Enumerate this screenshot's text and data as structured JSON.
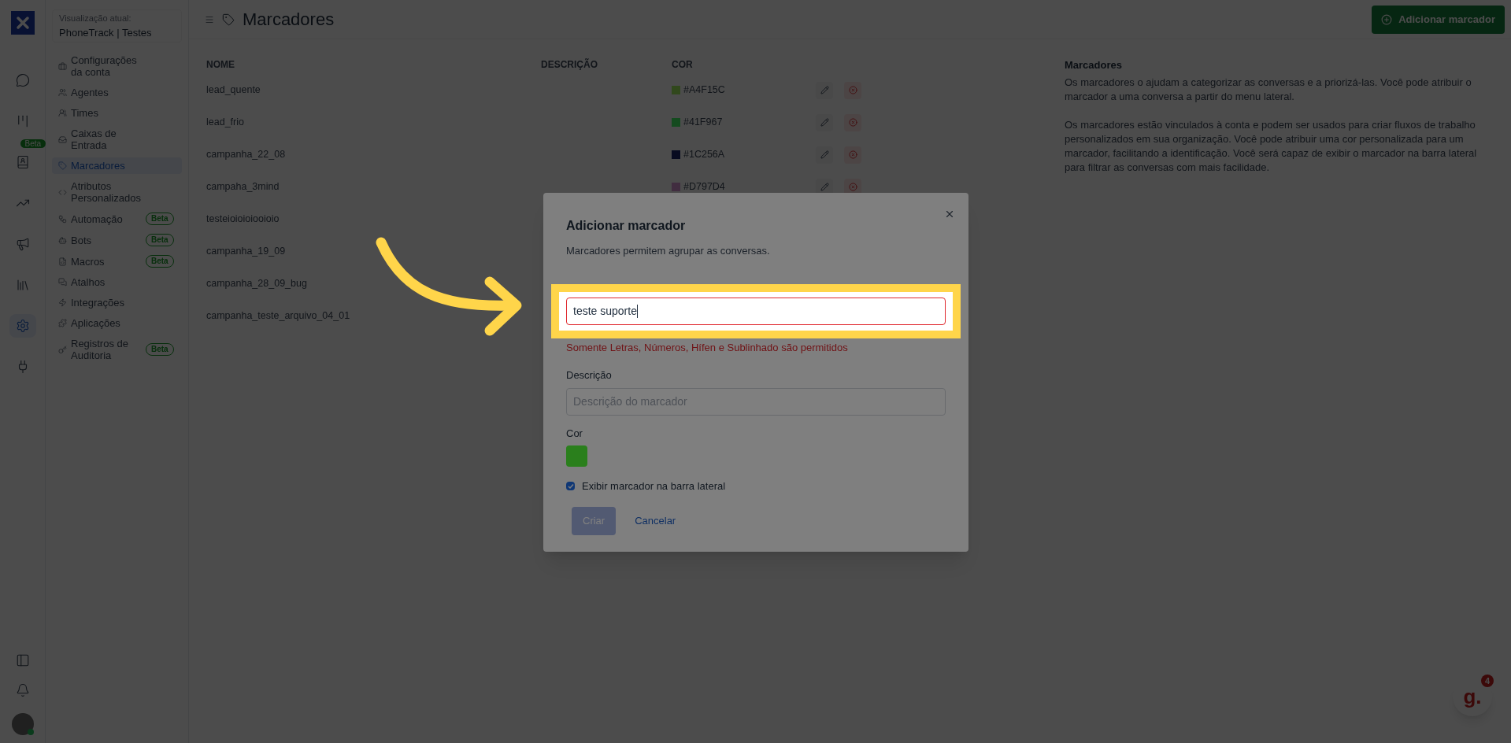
{
  "rail": {
    "items": [
      {
        "selected": false
      },
      {
        "selected": false,
        "badge": "Beta"
      },
      {
        "selected": false
      },
      {
        "selected": false
      },
      {
        "selected": false
      },
      {
        "selected": false
      },
      {
        "selected": true
      },
      {
        "selected": false
      }
    ],
    "notifications": {
      "selected": false
    }
  },
  "settings_sidebar": {
    "context_label": "Visualização atual:",
    "account": "PhoneTrack | Testes",
    "items": [
      {
        "label": "Configurações da conta",
        "selected": false
      },
      {
        "label": "Agentes",
        "selected": false
      },
      {
        "label": "Times",
        "selected": false
      },
      {
        "label": "Caixas de Entrada",
        "selected": false
      },
      {
        "label": "Marcadores",
        "selected": true
      },
      {
        "label": "Atributos Personalizados",
        "selected": false
      },
      {
        "label": "Automação",
        "selected": false,
        "badge": "Beta"
      },
      {
        "label": "Bots",
        "selected": false,
        "badge": "Beta"
      },
      {
        "label": "Macros",
        "selected": false,
        "badge": "Beta"
      },
      {
        "label": "Atalhos",
        "selected": false
      },
      {
        "label": "Integrações",
        "selected": false
      },
      {
        "label": "Aplicações",
        "selected": false
      },
      {
        "label": "Registros de Auditoria",
        "selected": false,
        "badge": "Beta"
      }
    ]
  },
  "header": {
    "title": "Marcadores",
    "add_button": "Adicionar marcador"
  },
  "table": {
    "columns": [
      "NOME",
      "DESCRIÇÃO",
      "COR"
    ],
    "rows": [
      {
        "name": "lead_quente",
        "color_hex": "#A4F15C",
        "color": "#31481c"
      },
      {
        "name": "lead_frio",
        "color_hex": "#41F967",
        "color": "#144b1f"
      },
      {
        "name": "campanha_22_08",
        "color_hex": "#1C256A",
        "color": "#080b20"
      },
      {
        "name": "campaha_3mind",
        "color_hex": "#D797D4",
        "color": "#412d40"
      },
      {
        "name": "testeioioioiooioio"
      },
      {
        "name": "campanha_19_09"
      },
      {
        "name": "campanha_28_09_bug"
      },
      {
        "name": "campanha_teste_arquivo_04_01"
      }
    ]
  },
  "info": {
    "title": "Marcadores",
    "paragraphs": [
      "Os marcadores o ajudam a categorizar as conversas e a priorizá-las. Você pode atribuir o marcador a uma conversa a partir do menu lateral.",
      "Os marcadores estão vinculados à conta e podem ser usados para criar fluxos de trabalho personalizados em sua organização. Você pode atribuir uma cor personalizada para um marcador, facilitando a identificação. Você será capaz de exibir o marcador na barra lateral para filtrar as conversas com mais facilidade."
    ]
  },
  "modal": {
    "title": "Adicionar marcador",
    "subtitle": "Marcadores permitem agrupar as conversas.",
    "name_value": "teste suporte",
    "error": "Somente Letras, Números, Hífen e Sublinhado são permitidos",
    "description_label": "Descrição",
    "description_placeholder": "Descrição do marcador",
    "color_label": "Cor",
    "color": "#2a7f1c",
    "show_in_sidebar": {
      "label": "Exibir marcador na barra lateral",
      "checked": true
    },
    "create_button": {
      "label": "Criar",
      "disabled": true
    },
    "cancel_button": "Cancelar"
  },
  "help_widget": {
    "logo_text": "g.",
    "badge": "4"
  }
}
